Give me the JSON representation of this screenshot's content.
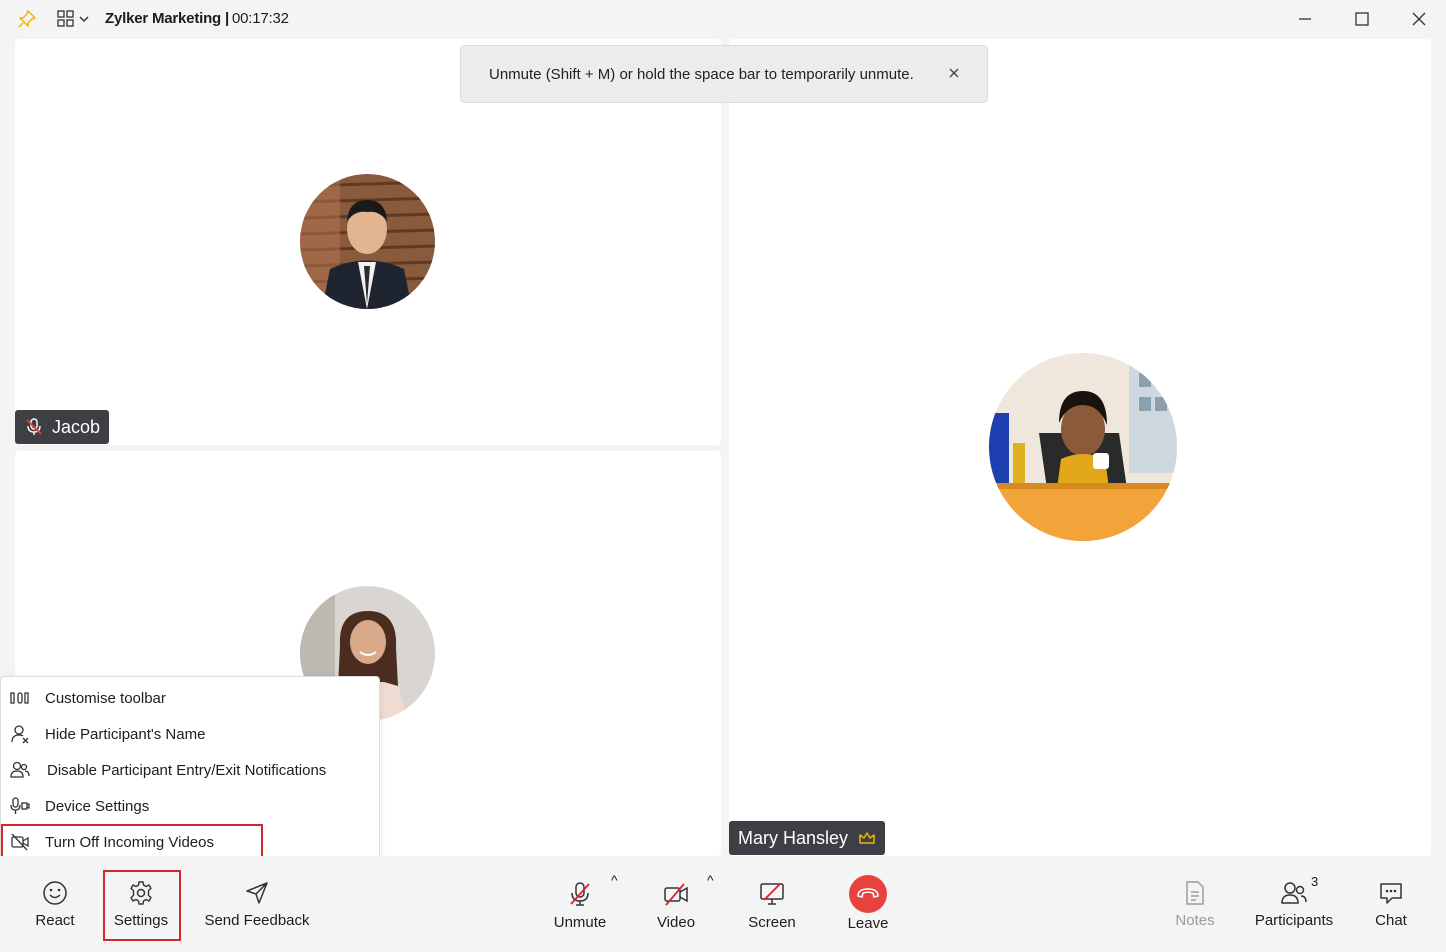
{
  "window": {
    "title": "Zylker Marketing |",
    "timer": "00:17:32"
  },
  "notification": {
    "text": "Unmute (Shift + M) or hold the space bar to temporarily unmute."
  },
  "participants": [
    {
      "name": "Jacob"
    },
    {
      "name": "Mary Hansley"
    }
  ],
  "settings_menu": {
    "items": [
      {
        "label": "Customise toolbar",
        "icon": "toolbar-icon"
      },
      {
        "label": "Hide Participant's Name",
        "icon": "user-hide-icon"
      },
      {
        "label": "Disable Participant Entry/Exit Notifications",
        "icon": "users-icon"
      },
      {
        "label": "Device Settings",
        "icon": "device-icon"
      },
      {
        "label": "Turn Off Incoming Videos",
        "icon": "video-off-icon"
      }
    ]
  },
  "toolbar": {
    "react": "React",
    "settings": "Settings",
    "send_feedback": "Send Feedback",
    "unmute": "Unmute",
    "video": "Video",
    "screen": "Screen",
    "leave": "Leave",
    "notes": "Notes",
    "participants": "Participants",
    "participants_count": "3",
    "chat": "Chat",
    "caret": "^"
  },
  "colors": {
    "leave": "#e8423f",
    "highlight": "#d6262b",
    "muted_icon": "#d6262b",
    "crown": "#f0b400"
  }
}
